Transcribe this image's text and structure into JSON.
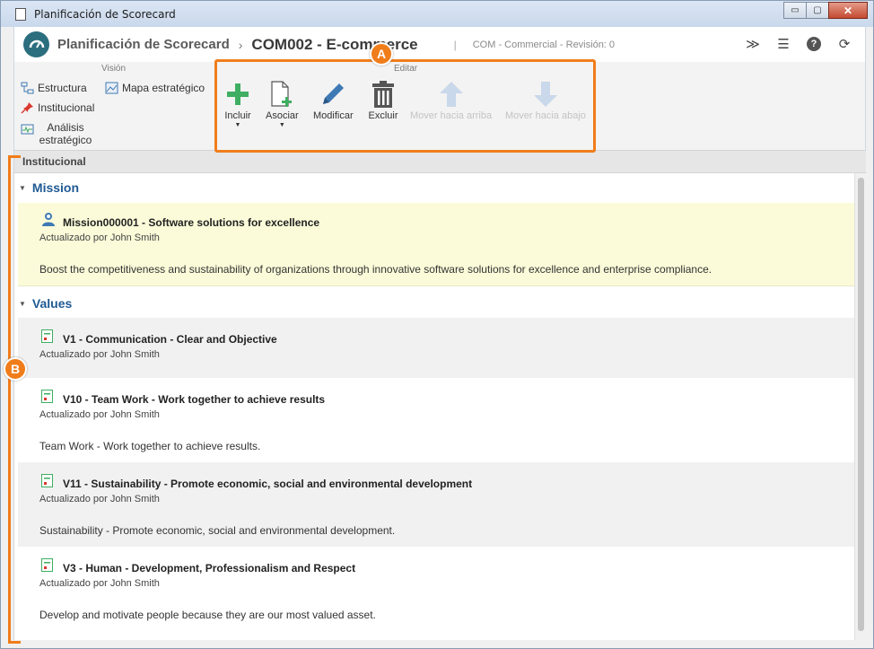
{
  "window": {
    "title": "Planificación de Scorecard",
    "controls": {
      "minimize": "▭",
      "maximize": "▢",
      "close": "✕"
    }
  },
  "header": {
    "app_title": "Planificación de Scorecard",
    "separator": "›",
    "record_title": "COM002 - E-commerce",
    "pipe": "|",
    "subtitle": "COM - Commercial - Revisión: 0",
    "tools": [
      {
        "name": "collapse-icon",
        "glyph": "≫"
      },
      {
        "name": "list-icon",
        "glyph": "☰"
      },
      {
        "name": "help-icon",
        "glyph": "?"
      },
      {
        "name": "refresh-icon",
        "glyph": "⟳"
      }
    ]
  },
  "ribbon": {
    "vision_label": "Visión",
    "edit_label": "Editar",
    "vision_items": [
      {
        "label": "Estructura",
        "icon": "structure-icon"
      },
      {
        "label": "Mapa estratégico",
        "icon": "strategic-map-icon"
      },
      {
        "label": "Institucional",
        "icon": "pin-icon"
      },
      {
        "label": "Análisis estratégico",
        "icon": "analysis-icon"
      }
    ],
    "edit_buttons": [
      {
        "label": "Incluir",
        "icon": "plus-icon",
        "enabled": true,
        "dropdown": true
      },
      {
        "label": "Asociar",
        "icon": "associate-icon",
        "enabled": true,
        "dropdown": true
      },
      {
        "label": "Modificar",
        "icon": "pencil-icon",
        "enabled": true,
        "dropdown": false
      },
      {
        "label": "Excluir",
        "icon": "trash-icon",
        "enabled": true,
        "dropdown": false
      },
      {
        "label": "Mover hacia arriba",
        "icon": "arrow-up-icon",
        "enabled": false,
        "dropdown": false
      },
      {
        "label": "Mover hacia abajo",
        "icon": "arrow-down-icon",
        "enabled": false,
        "dropdown": false
      }
    ]
  },
  "callouts": {
    "a": "A",
    "b": "B"
  },
  "section": {
    "title": "Institucional"
  },
  "groups": {
    "mission": {
      "title": "Mission",
      "item": {
        "title": "Mission000001 - Software solutions for excellence",
        "meta": "Actualizado por John Smith",
        "description": "Boost the competitiveness and sustainability of organizations through innovative software solutions for excellence and enterprise compliance."
      }
    },
    "values": {
      "title": "Values",
      "items": [
        {
          "title": "V1 - Communication - Clear and Objective",
          "meta": "Actualizado por John Smith",
          "description": ""
        },
        {
          "title": "V10 - Team Work - Work together to achieve results",
          "meta": "Actualizado por John Smith",
          "description": "Team Work - Work together to achieve results."
        },
        {
          "title": "V11 - Sustainability - Promote economic, social and environmental development",
          "meta": "Actualizado por John Smith",
          "description": "Sustainability - Promote economic, social and environmental development."
        },
        {
          "title": "V3 - Human - Development, Professionalism and Respect",
          "meta": "Actualizado por John Smith",
          "description": "Develop and motivate people because they are our most valued asset."
        }
      ]
    }
  },
  "colors": {
    "accent": "#f07d1a",
    "link": "#1f5a94",
    "mission_bg": "#fbfbd9",
    "plus_green": "#3fae62",
    "icon_blue": "#3f79b3"
  }
}
